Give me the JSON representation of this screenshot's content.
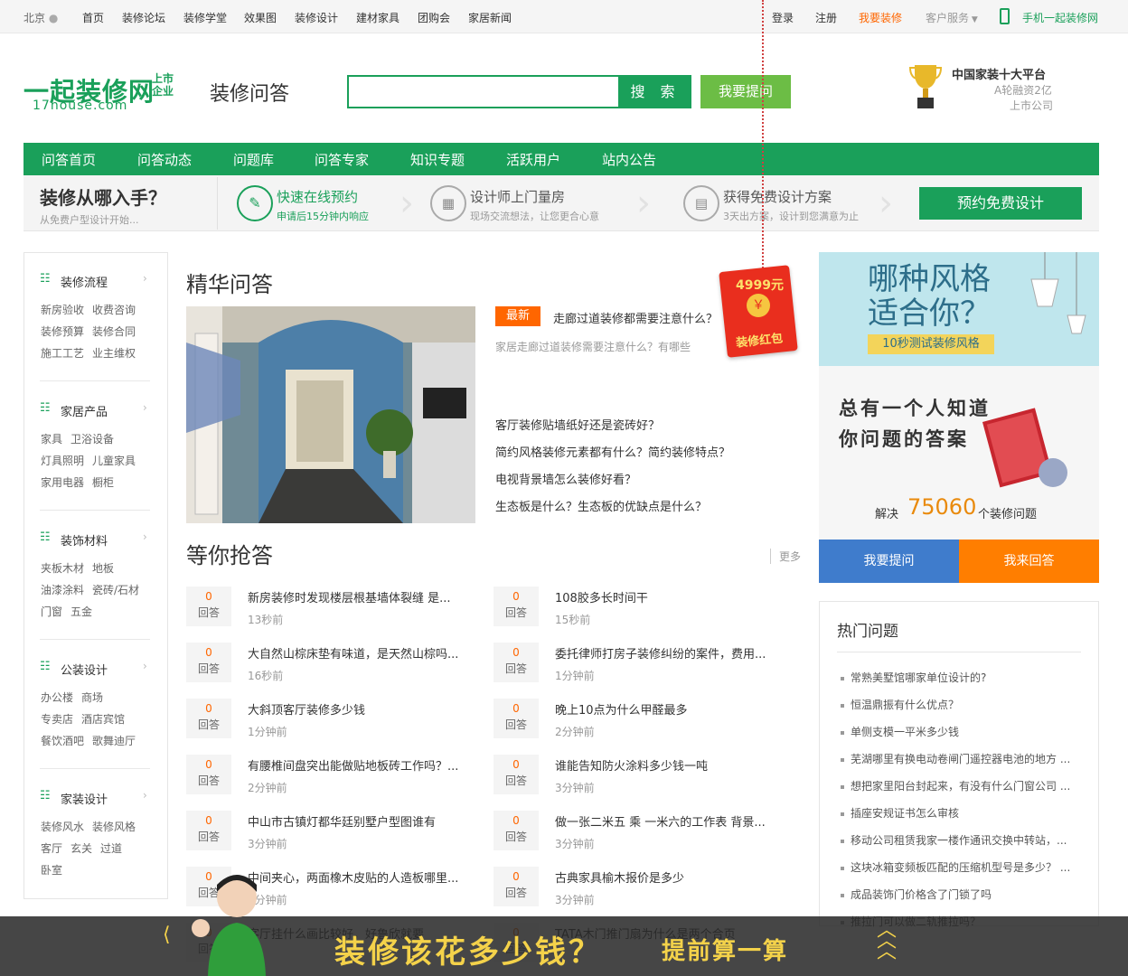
{
  "topbar": {
    "city": "北京",
    "nav": [
      "首页",
      "装修论坛",
      "装修学堂",
      "效果图",
      "装修设计",
      "建材家具",
      "团购会",
      "家居新闻"
    ],
    "login": "登录",
    "register": "注册",
    "want_decor": "我要装修",
    "service": "客户服务",
    "mobile": "手机一起装修网"
  },
  "header": {
    "logo": "一起装修网",
    "logo_tag": "上市企业",
    "logo_sub": "17house.com",
    "page_title": "装修问答",
    "search_placeholder": "",
    "search_btn": "搜 索",
    "ask_btn": "我要提问",
    "platform_title": "中国家装十大平台",
    "platform_line2": "A轮融资2亿",
    "platform_line3": "上市公司"
  },
  "nav": [
    "问答首页",
    "问答动态",
    "问题库",
    "问答专家",
    "知识专题",
    "活跃用户",
    "站内公告"
  ],
  "strip": {
    "title": "装修从哪入手？",
    "sub": "从免费户型设计开始...",
    "steps": [
      {
        "title": "快速在线预约",
        "sub": "申请后15分钟内响应"
      },
      {
        "title": "设计师上门量房",
        "sub": "现场交流想法，让您更合心意"
      },
      {
        "title": "获得免费设计方案",
        "sub": "3天出方案，设计到您满意为止"
      }
    ],
    "cta": "预约免费设计"
  },
  "sidebar": [
    {
      "title": "装修流程",
      "links": [
        [
          "新房验收",
          "收费咨询"
        ],
        [
          "装修预算",
          "装修合同"
        ],
        [
          "施工工艺",
          "业主维权"
        ]
      ]
    },
    {
      "title": "家居产品",
      "links": [
        [
          "家具",
          "卫浴设备"
        ],
        [
          "灯具照明",
          "儿童家具"
        ],
        [
          "家用电器",
          "橱柜"
        ]
      ]
    },
    {
      "title": "装饰材料",
      "links": [
        [
          "夹板木材",
          "地板"
        ],
        [
          "油漆涂料",
          "瓷砖/石材"
        ],
        [
          "门窗",
          "五金"
        ]
      ]
    },
    {
      "title": "公装设计",
      "links": [
        [
          "办公楼",
          "商场"
        ],
        [
          "专卖店",
          "酒店宾馆"
        ],
        [
          "餐饮酒吧",
          "歌舞迪厅"
        ]
      ]
    },
    {
      "title": "家装设计",
      "links": [
        [
          "装修风水",
          "装修风格"
        ],
        [
          "客厅",
          "玄关",
          "过道"
        ],
        [
          "卧室"
        ]
      ]
    }
  ],
  "featured": {
    "title": "精华问答",
    "badge": "最新",
    "question": "走廊过道装修都需要注意什么？",
    "desc": "家居走廊过道装修需要注意什么？有哪些",
    "links": [
      "客厅装修贴墙纸好还是瓷砖好？",
      "简约风格装修元素都有什么？简约装修特点？",
      "电视背景墙怎么装修好看？",
      "生态板是什么？生态板的优缺点是什么？"
    ]
  },
  "waiting": {
    "title": "等你抢答",
    "more": "更多",
    "answer_label": "回答",
    "items": [
      {
        "count": "0",
        "q": "新房装修时发现楼层根基墙体裂缝 是...",
        "t": "13秒前"
      },
      {
        "count": "0",
        "q": "108胶多长时间干",
        "t": "15秒前"
      },
      {
        "count": "0",
        "q": "大自然山棕床垫有味道，是天然山棕吗...",
        "t": "16秒前"
      },
      {
        "count": "0",
        "q": "委托律师打房子装修纠纷的案件，费用...",
        "t": "1分钟前"
      },
      {
        "count": "0",
        "q": "大斜顶客厅装修多少钱",
        "t": "1分钟前"
      },
      {
        "count": "0",
        "q": "晚上10点为什么甲醛最多",
        "t": "2分钟前"
      },
      {
        "count": "0",
        "q": "有腰椎间盘突出能做贴地板砖工作吗？...",
        "t": "2分钟前"
      },
      {
        "count": "0",
        "q": "谁能告知防火涂料多少钱一吨",
        "t": "3分钟前"
      },
      {
        "count": "0",
        "q": "中山市古镇灯都华廷别墅户型图谁有",
        "t": "3分钟前"
      },
      {
        "count": "0",
        "q": "做一张二米五 乘 一米六的工作表 背景...",
        "t": "3分钟前"
      },
      {
        "count": "0",
        "q": "中间夹心，两面橡木皮贴的人造板哪里...",
        "t": "3分钟前"
      },
      {
        "count": "0",
        "q": "古典家具榆木报价是多少",
        "t": "3分钟前"
      },
      {
        "count": "0",
        "q": "客厅挂什么画比较好，好鲁欣就要",
        "t": ""
      },
      {
        "count": "0",
        "q": "TATA木门推门扇为什么是两个合页",
        "t": ""
      }
    ]
  },
  "ads": {
    "style_title": "哪种风格适合你？",
    "style_tag": "10秒测试装修风格",
    "know_line1": "总有一个人知道",
    "know_line2": "你问题的答案",
    "solved_prefix": "解决",
    "solved_count": "75060",
    "solved_suffix": "个装修问题",
    "btn_ask": "我要提问",
    "btn_answer": "我来回答"
  },
  "hot": {
    "title": "热门问题",
    "items": [
      "常熟美墅馆哪家单位设计的?",
      "恒温鼎振有什么优点？",
      "单侧支模一平米多少钱",
      "芜湖哪里有换电动卷闸门遥控器电池的地方 ...",
      "想把家里阳台封起来，有没有什么门窗公司 ...",
      "插座安规证书怎么审核",
      "移动公司租赁我家一楼作通讯交换中转站，...",
      "这块冰箱变频板匹配的压缩机型号是多少？ ...",
      "成品装饰门价格含了门锁了吗",
      "推拉门可以做二轨推拉吗？"
    ]
  },
  "redpacket": {
    "amount": "4999元",
    "coin": "￥",
    "label": "装修红包"
  },
  "footer": {
    "slogan": "装修该花多少钱？",
    "sub": "提前算一算"
  },
  "colors": {
    "brand": "#1aa05a",
    "orange": "#ff6600",
    "blue": "#3f7ccc",
    "footer_text": "#f4d24a"
  }
}
